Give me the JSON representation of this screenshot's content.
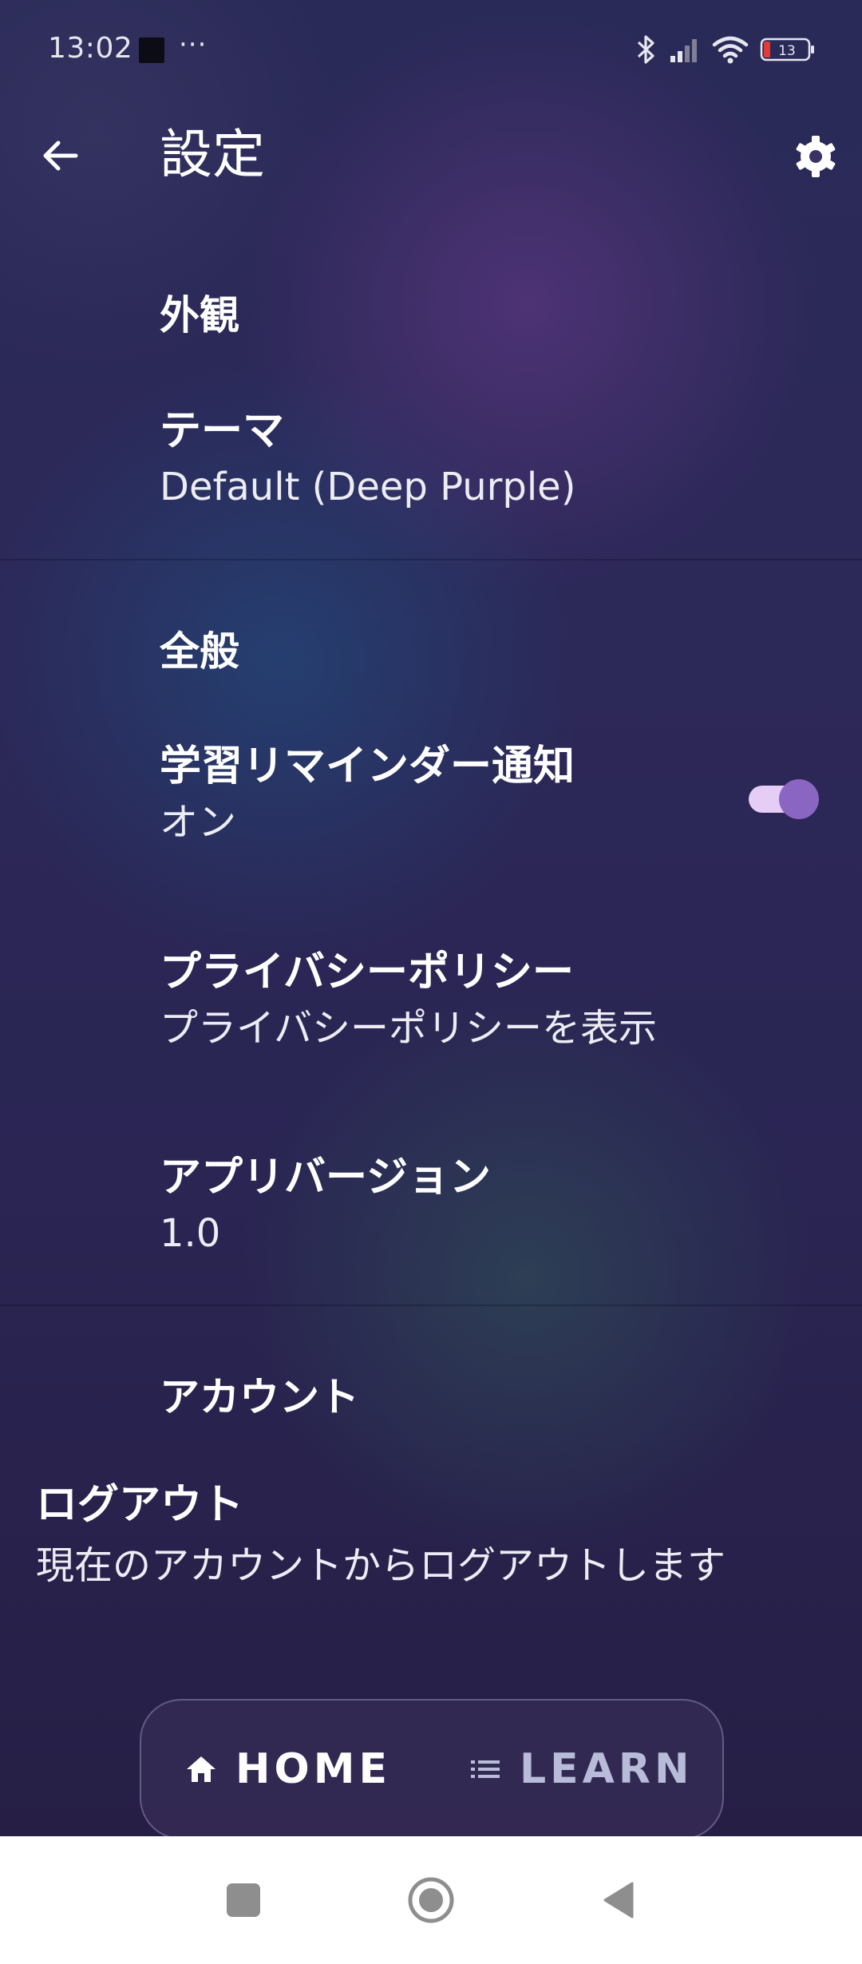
{
  "status_bar": {
    "time": "13:02",
    "dots": "···",
    "battery_level": "13",
    "icons": [
      "notification-square-icon",
      "bluetooth-icon",
      "signal-icon",
      "wifi-icon",
      "battery-icon"
    ]
  },
  "header": {
    "title": "設定",
    "back_icon": "arrow-left-icon",
    "settings_icon": "gear-icon"
  },
  "sections": {
    "appearance": {
      "heading": "外観",
      "theme": {
        "title": "テーマ",
        "value": "Default (Deep Purple)"
      }
    },
    "general": {
      "heading": "全般",
      "reminder": {
        "title": "学習リマインダー通知",
        "value": "オン",
        "enabled": true
      },
      "privacy": {
        "title": "プライバシーポリシー",
        "subtitle": "プライバシーポリシーを表示"
      },
      "version": {
        "title": "アプリバージョン",
        "value": "1.0"
      }
    },
    "account": {
      "heading": "アカウント",
      "logout": {
        "title": "ログアウト",
        "subtitle": "現在のアカウントからログアウトします"
      }
    }
  },
  "bottom_nav": {
    "items": [
      {
        "label": "HOME",
        "icon": "home-icon",
        "active": true
      },
      {
        "label": "LEARN",
        "icon": "list-icon",
        "active": false
      }
    ]
  },
  "system_nav": {
    "buttons": [
      "recents-square-icon",
      "home-circle-icon",
      "back-triangle-icon"
    ]
  },
  "colors": {
    "accent": "#8a66c2",
    "toggle_track": "#e6cdf6",
    "battery_low": "#e53935"
  }
}
